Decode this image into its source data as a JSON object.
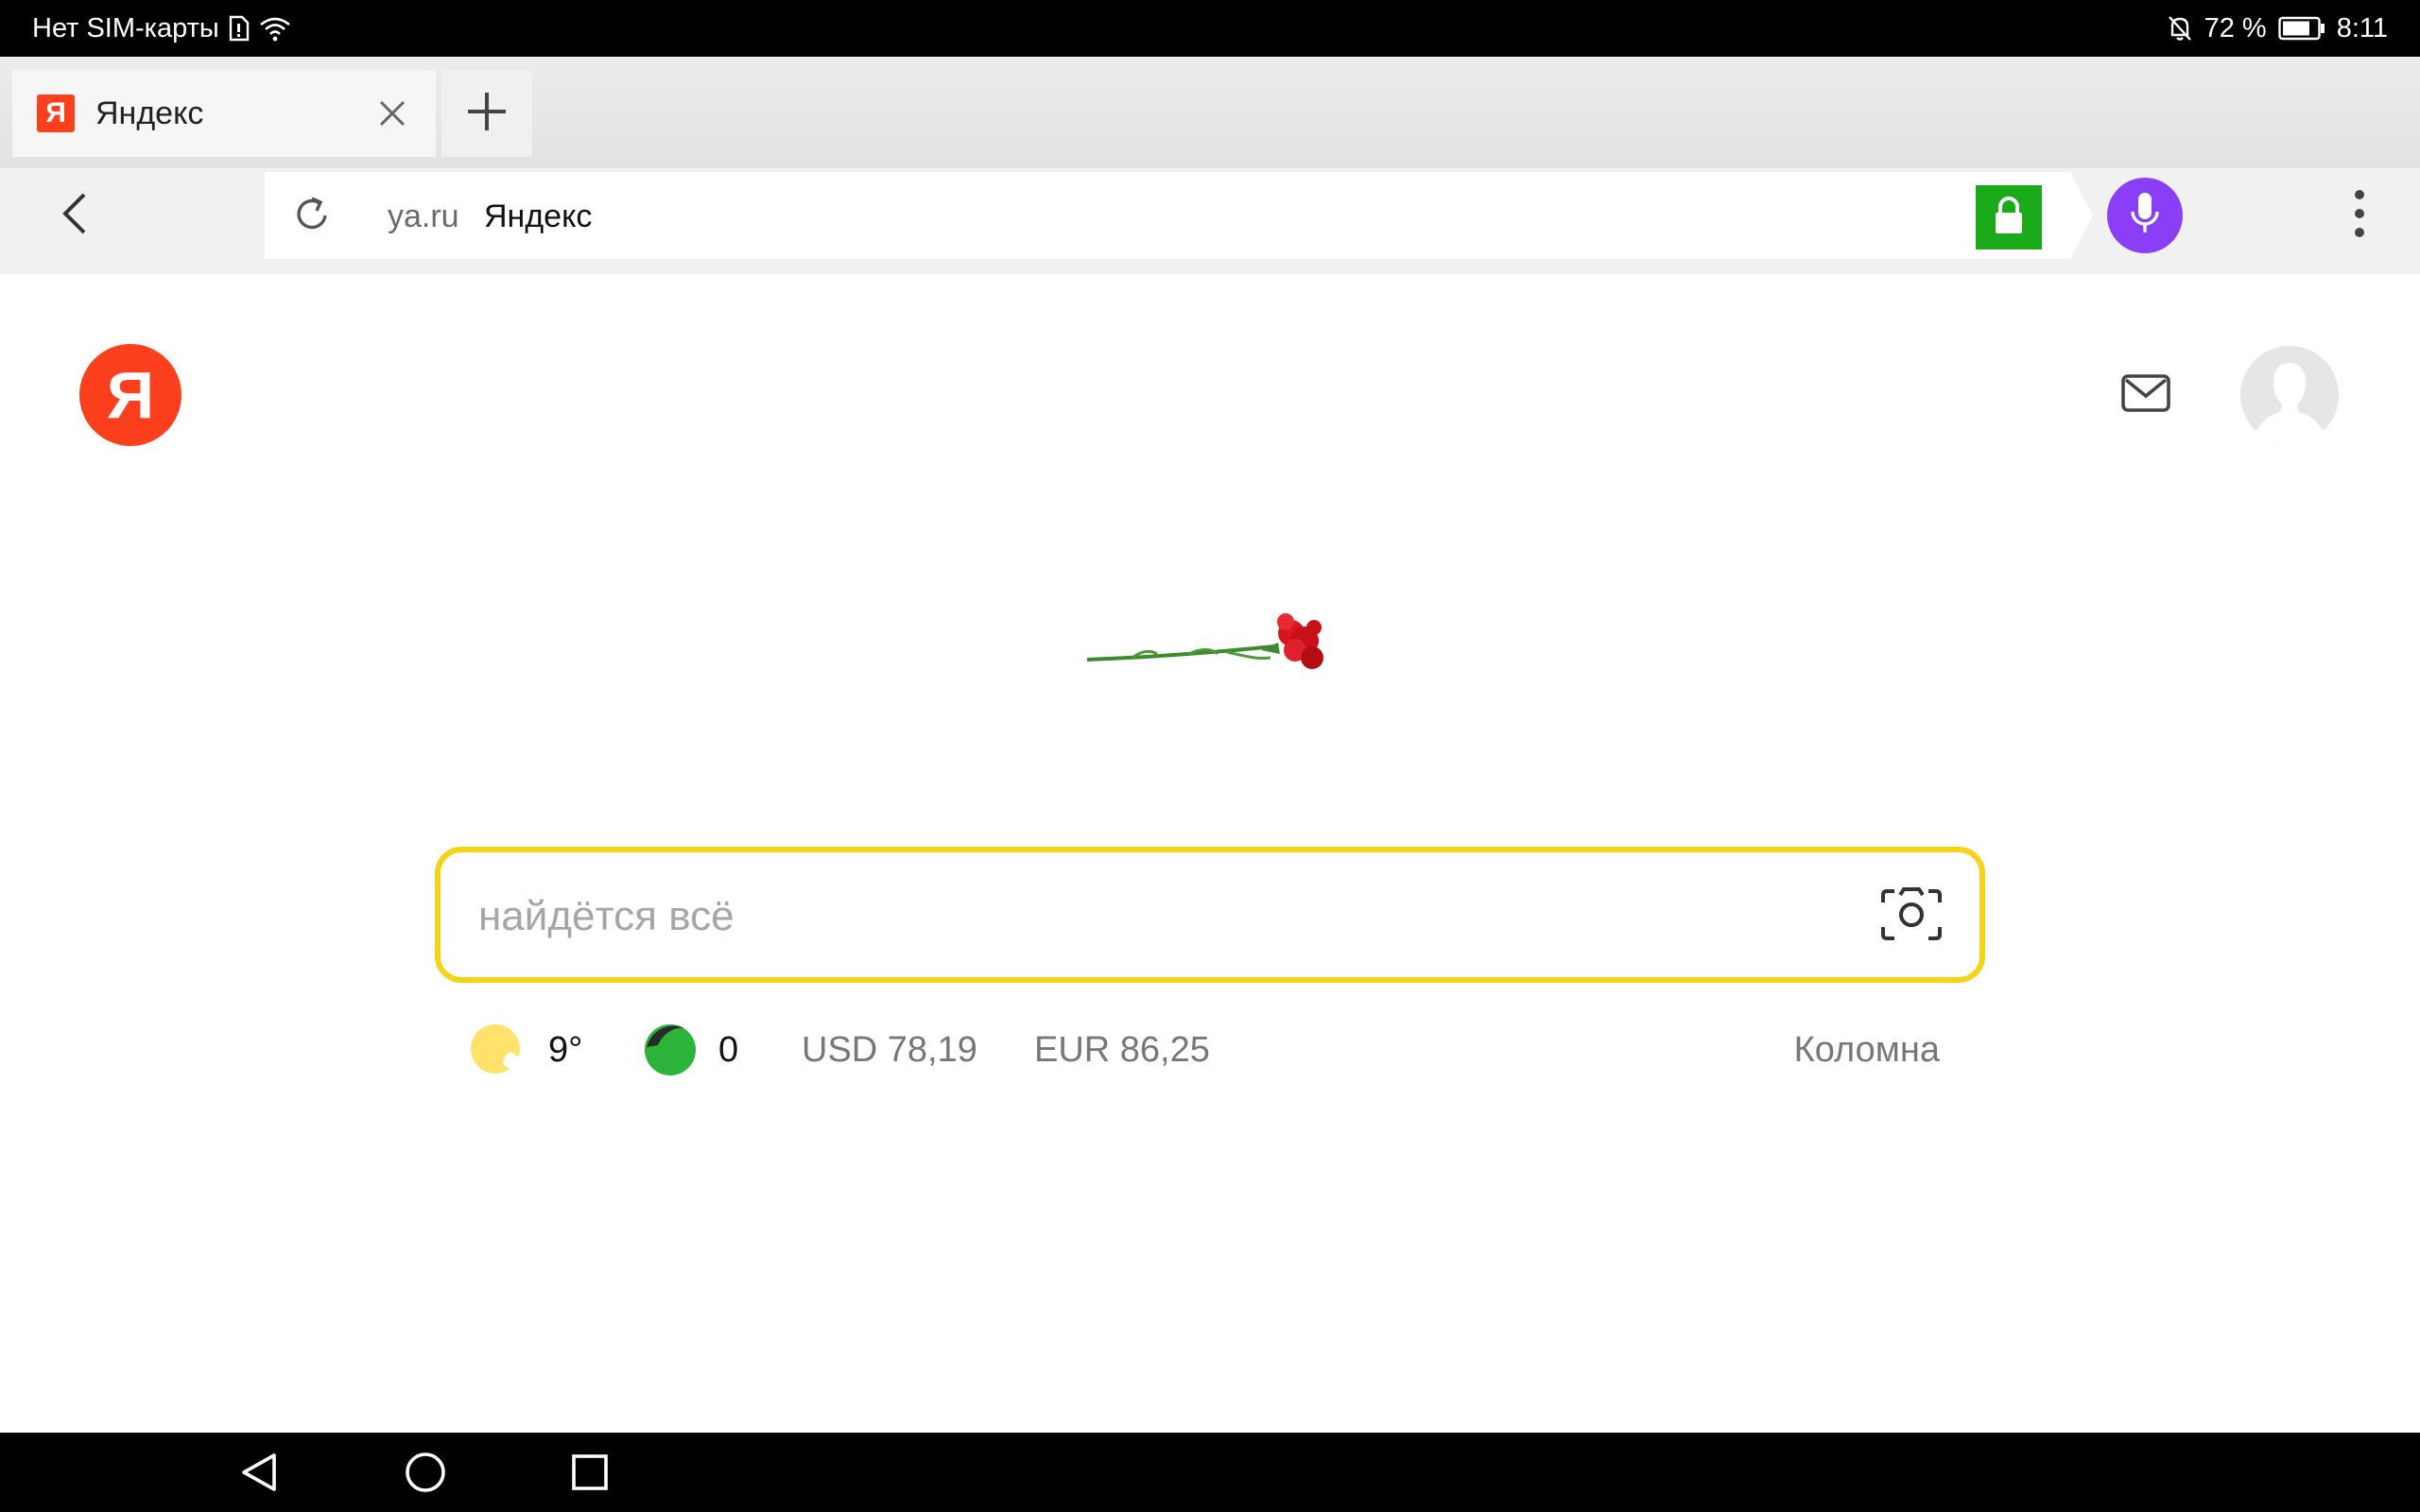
{
  "status_bar": {
    "carrier": "Нет SIM-карты",
    "battery_percent": "72 %",
    "time": "8:11",
    "icons": [
      "sim-icon",
      "wifi-icon",
      "mute-icon",
      "battery-icon"
    ]
  },
  "browser": {
    "tab": {
      "favicon": "Я",
      "title": "Яндекс"
    },
    "address": {
      "host": "ya.ru",
      "title": "Яндекс"
    },
    "accent": {
      "lock": "#1aaa1a",
      "mic": "#8a3ef5"
    }
  },
  "page": {
    "logo_letter": "Я",
    "logo_color": "#fc3f1d",
    "search": {
      "placeholder": "найдётся всё",
      "border_color": "#f5d31a"
    },
    "info": {
      "weather": "9°",
      "traffic": "0",
      "usd": "USD 78,19",
      "eur": "EUR 86,25",
      "city": "Коломна"
    }
  },
  "nav_bar": {
    "icons": [
      "back-triangle-icon",
      "home-circle-icon",
      "recents-square-icon"
    ]
  }
}
